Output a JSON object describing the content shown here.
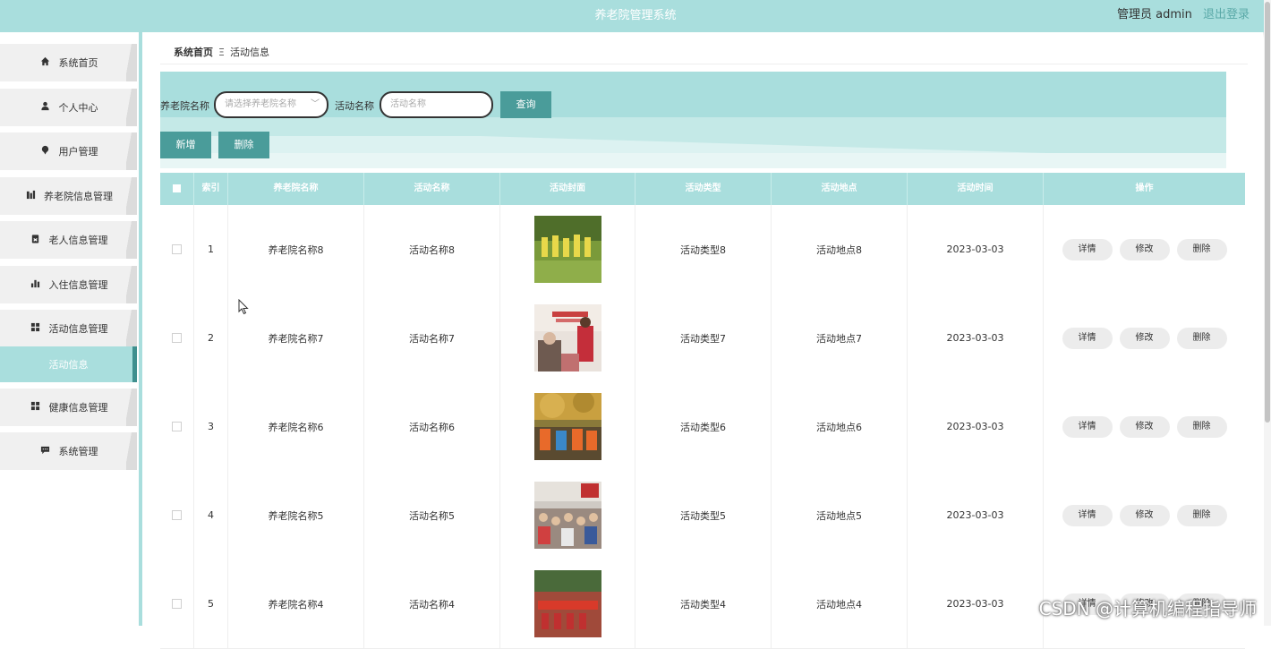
{
  "header": {
    "app_title": "养老院管理系统",
    "user_label": "管理员 admin",
    "logout_label": "退出登录"
  },
  "sidebar": {
    "items": [
      {
        "label": "系统首页",
        "icon": "home-icon"
      },
      {
        "label": "个人中心",
        "icon": "user-icon"
      },
      {
        "label": "用户管理",
        "icon": "pin-icon"
      },
      {
        "label": "养老院信息管理",
        "icon": "building-icon"
      },
      {
        "label": "老人信息管理",
        "icon": "clipboard-icon"
      },
      {
        "label": "入住信息管理",
        "icon": "bar-chart-icon"
      },
      {
        "label": "活动信息管理",
        "icon": "grid-icon"
      },
      {
        "label": "活动信息",
        "icon": ""
      },
      {
        "label": "健康信息管理",
        "icon": "grid-icon"
      },
      {
        "label": "系统管理",
        "icon": "chat-icon"
      }
    ]
  },
  "breadcrumb": {
    "home": "系统首页",
    "separator": "Ξ",
    "current": "活动信息"
  },
  "search": {
    "nursing_home_label": "养老院名称",
    "nursing_home_placeholder": "请选择养老院名称",
    "activity_label": "活动名称",
    "activity_placeholder": "活动名称",
    "query_button": "查询"
  },
  "actions": {
    "add_button": "新增",
    "delete_button": "删除"
  },
  "table": {
    "columns": [
      "索引",
      "养老院名称",
      "活动名称",
      "活动封面",
      "活动类型",
      "活动地点",
      "活动时间",
      "操作"
    ],
    "rows": [
      {
        "index": "1",
        "home": "养老院名称8",
        "name": "活动名称8",
        "type": "活动类型8",
        "place": "活动地点8",
        "time": "2023-03-03"
      },
      {
        "index": "2",
        "home": "养老院名称7",
        "name": "活动名称7",
        "type": "活动类型7",
        "place": "活动地点7",
        "time": "2023-03-03"
      },
      {
        "index": "3",
        "home": "养老院名称6",
        "name": "活动名称6",
        "type": "活动类型6",
        "place": "活动地点6",
        "time": "2023-03-03"
      },
      {
        "index": "4",
        "home": "养老院名称5",
        "name": "活动名称5",
        "type": "活动类型5",
        "place": "活动地点5",
        "time": "2023-03-03"
      },
      {
        "index": "5",
        "home": "养老院名称4",
        "name": "活动名称4",
        "type": "活动类型4",
        "place": "活动地点4",
        "time": "2023-03-03"
      }
    ],
    "row_actions": {
      "detail": "详情",
      "edit": "修改",
      "delete": "删除"
    }
  },
  "watermark": "CSDN @计算机编程指导师",
  "colors": {
    "primary": "#a9dedd",
    "button": "#4a9c9a",
    "link": "#5aa9a8"
  }
}
